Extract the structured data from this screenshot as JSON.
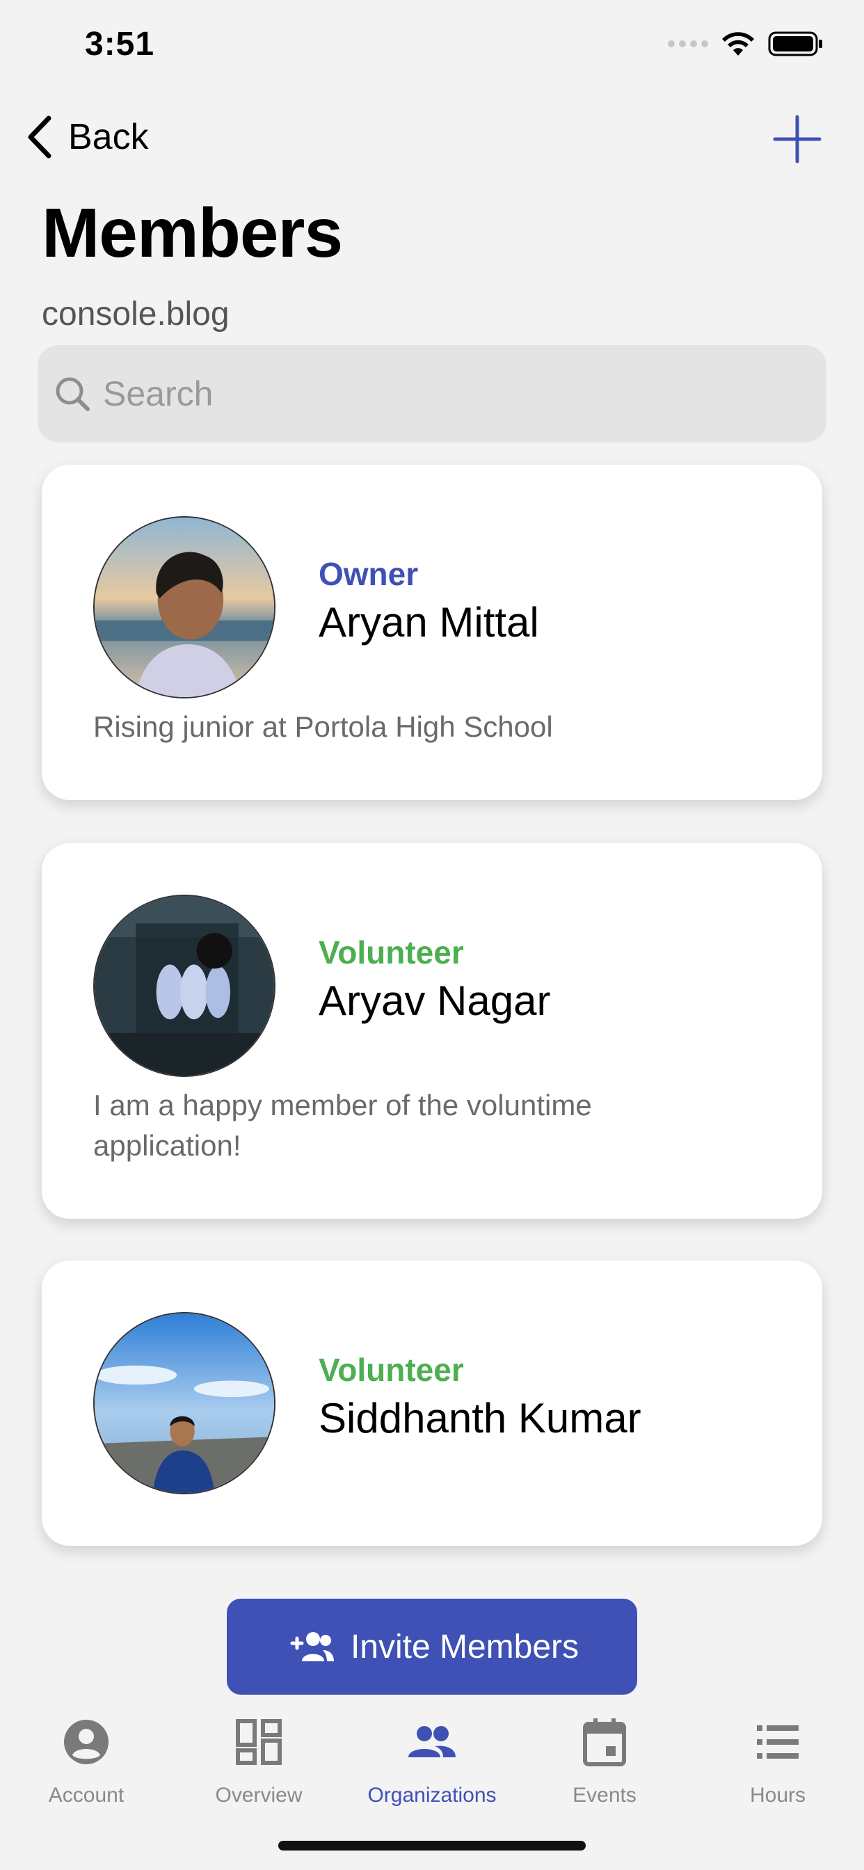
{
  "status_bar": {
    "time": "3:51"
  },
  "nav": {
    "back_label": "Back"
  },
  "header": {
    "title": "Members",
    "subtitle": "console.blog"
  },
  "search": {
    "placeholder": "Search",
    "value": ""
  },
  "members": [
    {
      "role": "Owner",
      "role_color": "#3f51b5",
      "name": "Aryan Mittal",
      "bio": "Rising junior at Portola High School"
    },
    {
      "role": "Volunteer",
      "role_color": "#4caf50",
      "name": "Aryav Nagar",
      "bio_line1": "I am a happy member of the voluntime",
      "bio_line2": "application!"
    },
    {
      "role": "Volunteer",
      "role_color": "#4caf50",
      "name": "Siddhanth Kumar",
      "bio": ""
    }
  ],
  "invite": {
    "label": "Invite Members",
    "icon": "person-add-icon"
  },
  "tabs": [
    {
      "label": "Account",
      "icon": "account-circle-icon",
      "active": false
    },
    {
      "label": "Overview",
      "icon": "dashboard-icon",
      "active": false
    },
    {
      "label": "Organizations",
      "icon": "people-icon",
      "active": true
    },
    {
      "label": "Events",
      "icon": "calendar-icon",
      "active": false
    },
    {
      "label": "Hours",
      "icon": "list-icon",
      "active": false
    }
  ],
  "colors": {
    "accent": "#3f51b5",
    "volunteer": "#4caf50",
    "background": "#f3f3f3"
  }
}
